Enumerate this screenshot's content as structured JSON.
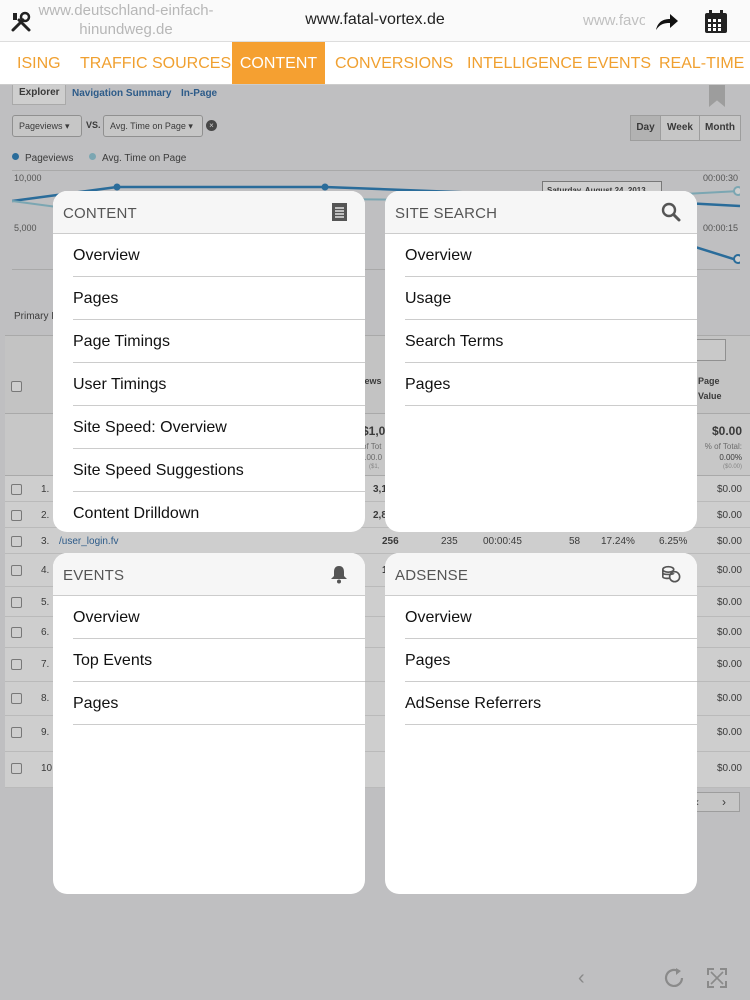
{
  "topbar": {
    "url_left": "www.deutschland-einfach-hinundweg.de",
    "url_center": "www.fatal-vortex.de",
    "url_right": "www.favo",
    "icons": [
      "wrench-screwdriver-icon",
      "share-arrow-icon",
      "calendar-icon"
    ]
  },
  "tabs": [
    {
      "label": "ISING",
      "active": false
    },
    {
      "label": "TRAFFIC SOURCES",
      "active": false
    },
    {
      "label": "CONTENT",
      "active": true
    },
    {
      "label": "CONVERSIONS",
      "active": false
    },
    {
      "label": "INTELLIGENCE EVENTS",
      "active": false
    },
    {
      "label": "REAL-TIME",
      "active": false
    }
  ],
  "background": {
    "subnav": {
      "explorer": "Explorer",
      "navigation_summary": "Navigation Summary",
      "in_page": "In-Page"
    },
    "metric1": "Pageviews",
    "vs": "VS.",
    "metric2": "Avg. Time on Page",
    "periods": [
      "Day",
      "Week",
      "Month"
    ],
    "legend": [
      "Pageviews",
      "Avg. Time on Page"
    ],
    "chart": {
      "y_left_top": "10,000",
      "y_left_mid": "5,000",
      "y_right_top": "00:00:30",
      "y_right_mid": "00:00:15",
      "tooltip": "Saturday, August 24, 2013"
    },
    "primary": "Primary I",
    "header_fragments": {
      "views": "views",
      "page_value": "Page",
      "page_value2": "Value"
    },
    "totals": {
      "left_value": "$1,0",
      "left_pct": "of Tot",
      "left_pct2": "100.0",
      "left_sub": "($1,",
      "right_value": "$0.00",
      "right_pct": "% of Total:",
      "right_pct2": "0.00%",
      "right_sub": "($0.00)"
    },
    "rows": [
      {
        "n": "1.",
        "partial": "3,1",
        "value": "$0.00"
      },
      {
        "n": "2.",
        "partial": "2,8",
        "value": "$0.00"
      },
      {
        "n": "3.",
        "page": "/user_login.fv",
        "pageviews": "256",
        "unique": "235",
        "time": "00:00:45",
        "entrances": "58",
        "bounce": "17.24%",
        "exit": "6.25%",
        "value": "$0.00"
      },
      {
        "n": "4.",
        "partial": "1",
        "value": "$0.00"
      },
      {
        "n": "5.",
        "value": "$0.00"
      },
      {
        "n": "6.",
        "value": "$0.00"
      },
      {
        "n": "7.",
        "value": "$0.00"
      },
      {
        "n": "8.",
        "value": "$0.00"
      },
      {
        "n": "9.",
        "value": "$0.00"
      },
      {
        "n": "10.",
        "value": "$0.00"
      }
    ]
  },
  "cards": {
    "content": {
      "title": "CONTENT",
      "icon": "document-icon",
      "items": [
        "Overview",
        "Pages",
        "Page Timings",
        "User Timings",
        "Site Speed: Overview",
        "Site Speed Suggestions",
        "Content Drilldown"
      ]
    },
    "site_search": {
      "title": "SITE SEARCH",
      "icon": "search-icon",
      "items": [
        "Overview",
        "Usage",
        "Search Terms",
        "Pages"
      ]
    },
    "events": {
      "title": "EVENTS",
      "icon": "bell-icon",
      "items": [
        "Overview",
        "Top Events",
        "Pages"
      ]
    },
    "adsense": {
      "title": "ADSENSE",
      "icon": "coins-icon",
      "items": [
        "Overview",
        "Pages",
        "AdSense Referrers"
      ]
    }
  },
  "bottombar": {
    "icons": [
      "back-arrow-icon",
      "refresh-icon",
      "fullscreen-icon"
    ]
  }
}
